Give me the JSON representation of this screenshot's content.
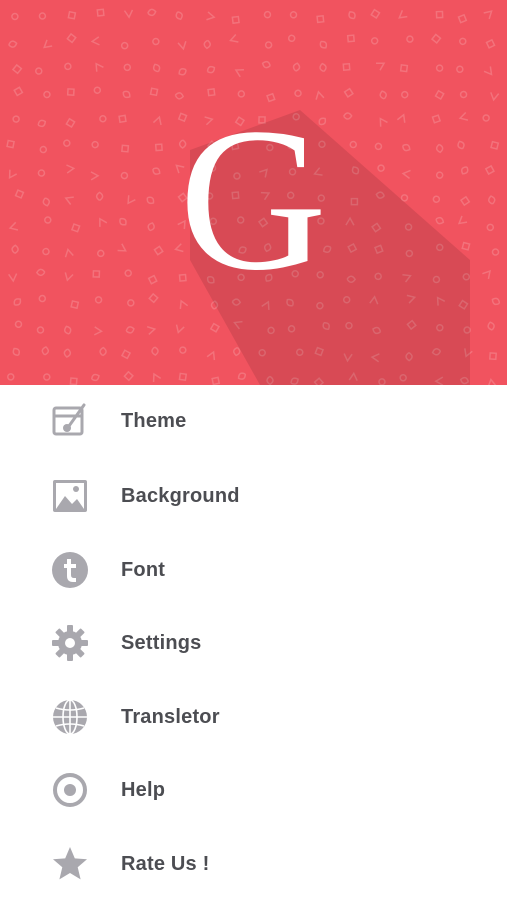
{
  "header": {
    "logo_letter": "G",
    "background_color": "#f1535f"
  },
  "menu": {
    "icon_color": "#a9a8ae",
    "items": [
      {
        "label": "Theme",
        "icon": "theme-icon"
      },
      {
        "label": "Background",
        "icon": "image-icon"
      },
      {
        "label": "Font",
        "icon": "font-t-icon"
      },
      {
        "label": "Settings",
        "icon": "gear-icon"
      },
      {
        "label": "Transletor",
        "icon": "globe-icon"
      },
      {
        "label": "Help",
        "icon": "help-icon"
      },
      {
        "label": "Rate Us !",
        "icon": "star-icon"
      }
    ]
  }
}
